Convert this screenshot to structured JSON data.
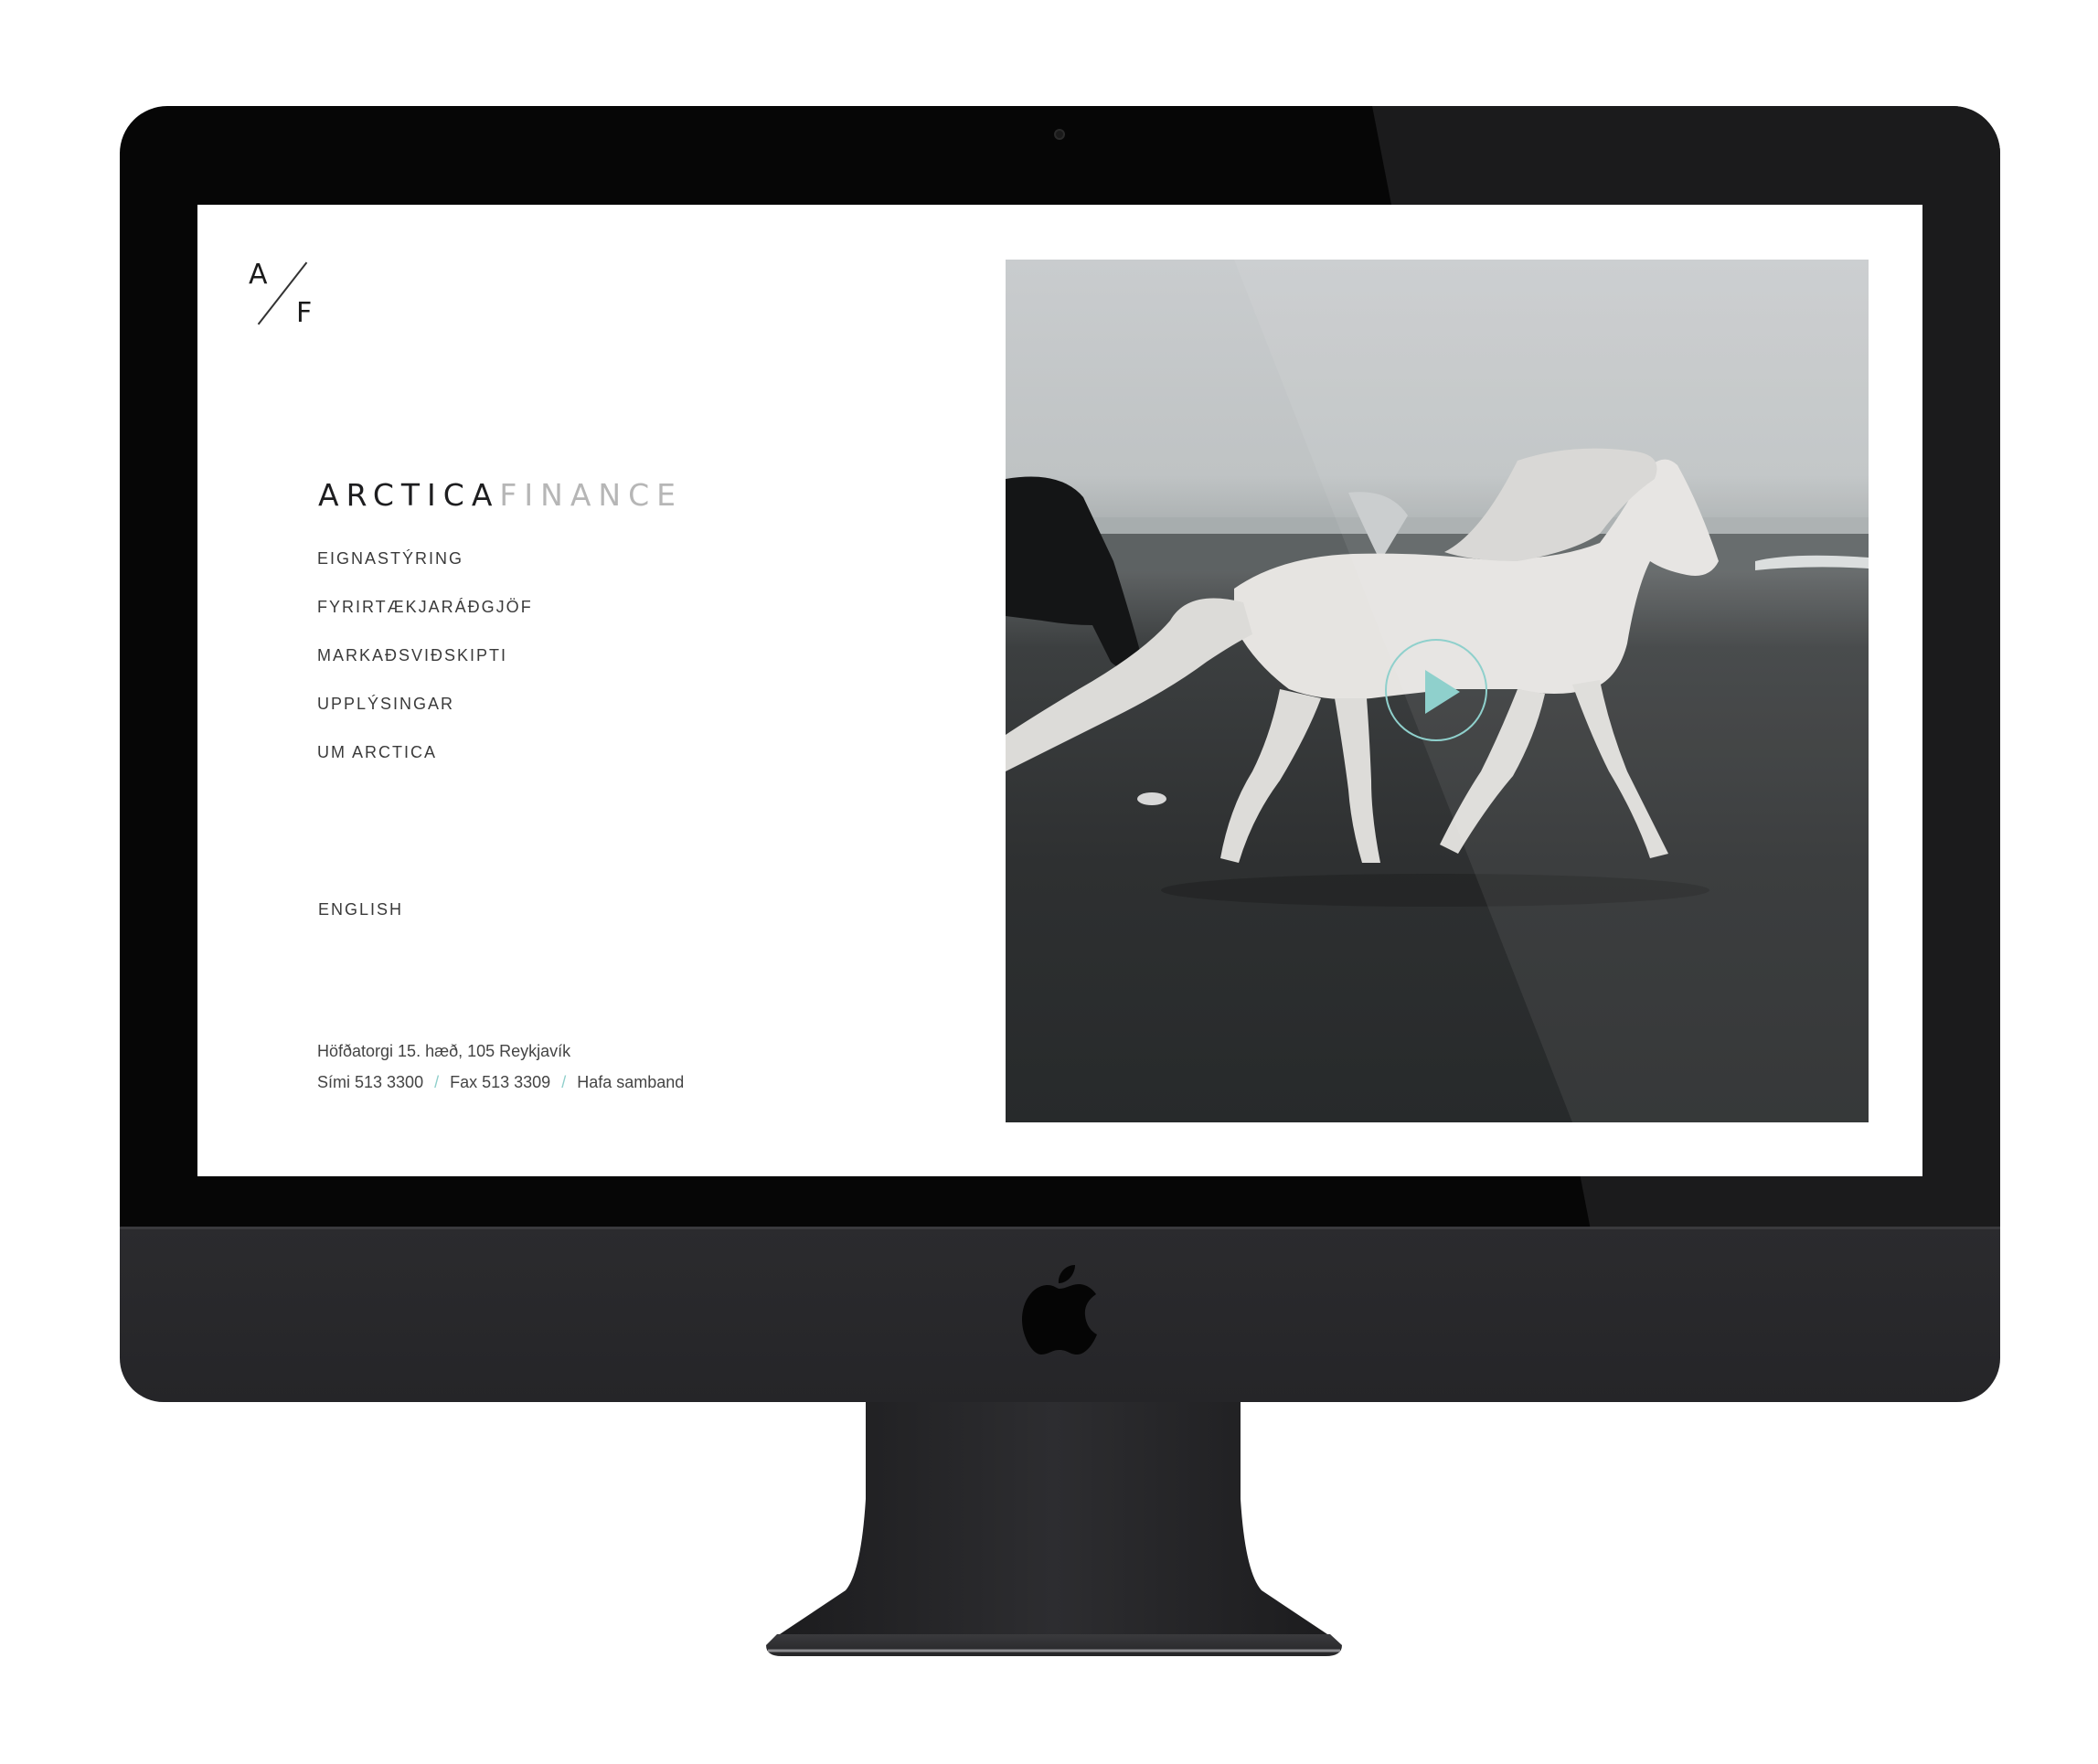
{
  "site": {
    "logo": {
      "left": "A",
      "right": "F"
    },
    "brand": {
      "main": "ARCTICA",
      "sub": "FINANCE"
    },
    "nav": [
      {
        "label": "EIGNASTÝRING"
      },
      {
        "label": "FYRIRTÆKJARÁÐGJÖF"
      },
      {
        "label": "MARKAÐSVIÐSKIPTI"
      },
      {
        "label": "UPPLÝSINGAR"
      },
      {
        "label": "UM ARCTICA"
      }
    ],
    "language": "ENGLISH",
    "footer": {
      "address": "Höfðatorgi 15. hæð, 105 Reykjavík",
      "phone": "Sími 513 3300",
      "fax": "Fax 513 3309",
      "contact_link": "Hafa samband",
      "separator": "/"
    },
    "video": {
      "play_icon": "play-icon",
      "accent": "#8fd0cc"
    }
  },
  "device": {
    "type": "iMac Pro",
    "color": "space-gray",
    "logo_icon": "apple-logo-icon"
  }
}
